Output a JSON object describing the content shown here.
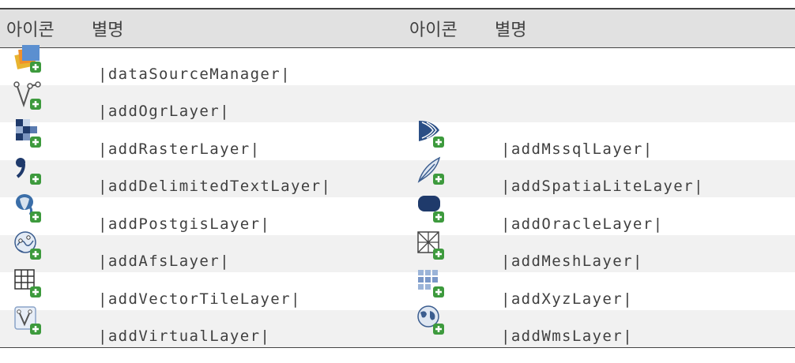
{
  "header": {
    "icon_col_left": "아이콘",
    "alias_col_left": "별명",
    "icon_col_right": "아이콘",
    "alias_col_right": "별명"
  },
  "rows": [
    {
      "left": {
        "icon": "data-source-manager-icon",
        "alias": "|dataSourceManager|"
      },
      "right": null
    },
    {
      "left": {
        "icon": "add-ogr-layer-icon",
        "alias": "|addOgrLayer|"
      },
      "right": null
    },
    {
      "left": {
        "icon": "add-raster-layer-icon",
        "alias": "|addRasterLayer|"
      },
      "right": {
        "icon": "add-mssql-layer-icon",
        "alias": "|addMssqlLayer|"
      }
    },
    {
      "left": {
        "icon": "add-delimited-text-layer-icon",
        "alias": "|addDelimitedTextLayer|"
      },
      "right": {
        "icon": "add-spatialite-layer-icon",
        "alias": "|addSpatiaLiteLayer|"
      }
    },
    {
      "left": {
        "icon": "add-postgis-layer-icon",
        "alias": "|addPostgisLayer|"
      },
      "right": {
        "icon": "add-oracle-layer-icon",
        "alias": "|addOracleLayer|"
      }
    },
    {
      "left": {
        "icon": "add-afs-layer-icon",
        "alias": "|addAfsLayer|"
      },
      "right": {
        "icon": "add-mesh-layer-icon",
        "alias": "|addMeshLayer|"
      }
    },
    {
      "left": {
        "icon": "add-vector-tile-layer-icon",
        "alias": "|addVectorTileLayer|"
      },
      "right": {
        "icon": "add-xyz-layer-icon",
        "alias": "|addXyzLayer|"
      }
    },
    {
      "left": {
        "icon": "add-virtual-layer-icon",
        "alias": "|addVirtualLayer|"
      },
      "right": {
        "icon": "add-wms-layer-icon",
        "alias": "|addWmsLayer|"
      }
    }
  ]
}
